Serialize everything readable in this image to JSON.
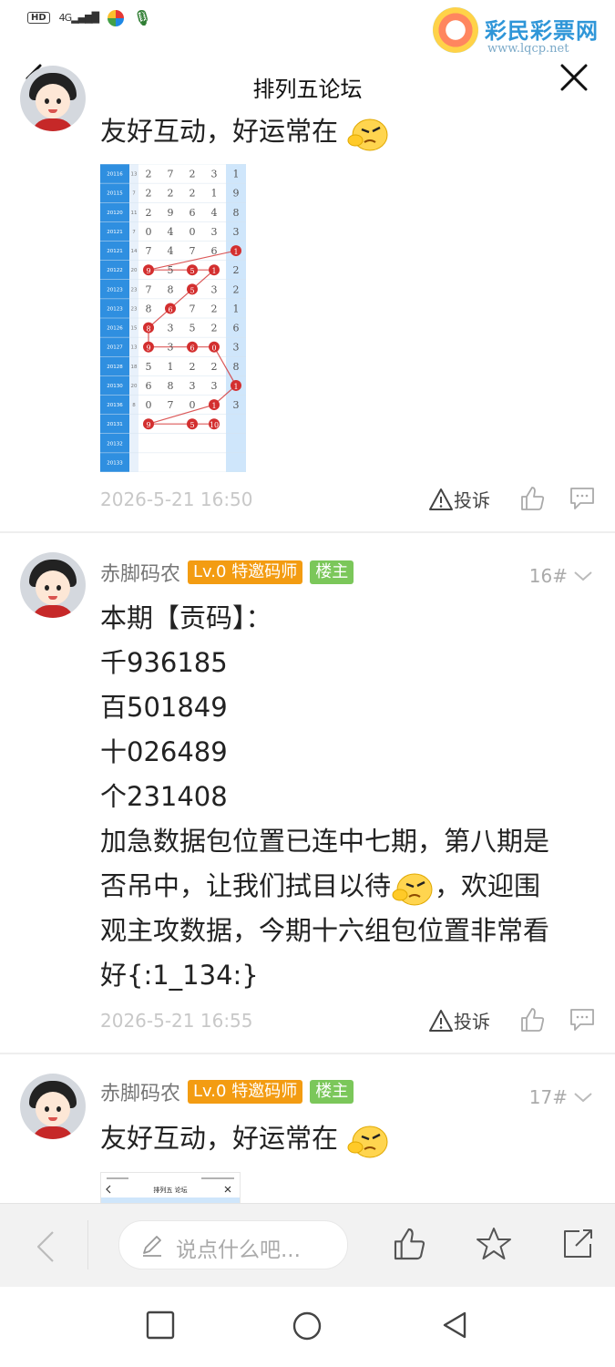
{
  "status": {
    "hd": "HD",
    "signal": "4G",
    "watermark_title": "彩民彩票网",
    "watermark_url": "www.lqcp.net"
  },
  "nav": {
    "title": "排列五论坛"
  },
  "post1": {
    "text": "友好互动，好运常在",
    "time": "2026-5-21 16:50",
    "report_label": "投诉"
  },
  "post2": {
    "author": "赤脚码农",
    "badge_level": "Lv.0 特邀码师",
    "badge_host": "楼主",
    "floor": "16#",
    "lines": [
      "本期【贡码】：",
      "千936185",
      "百501849",
      "十026489",
      "个231408",
      "加急数据包位置已连中七期，第八期是",
      "否吊中，让我们拭目以待",
      "，欢迎围",
      "观主攻数据，今期十六组包位置非常看",
      "好{:1_134:}"
    ],
    "time": "2026-5-21 16:55",
    "report_label": "投诉"
  },
  "post3": {
    "author": "赤脚码农",
    "badge_level": "Lv.0 特邀码师",
    "badge_host": "楼主",
    "floor": "17#",
    "text": "友好互动，好运常在",
    "thumb_title": "排列五 论坛"
  },
  "trend_chart": {
    "periods": [
      "20116",
      "20115",
      "20120",
      "20121",
      "20121",
      "20122",
      "20123",
      "20123",
      "20126",
      "20127",
      "20128",
      "20130",
      "20136",
      "20131",
      "20132",
      "20133"
    ],
    "sums": [
      "13",
      "7",
      "11",
      "7",
      "14",
      "20",
      "23",
      "23",
      "15",
      "13",
      "18",
      "20",
      "8",
      "",
      "",
      ""
    ],
    "rows": [
      [
        "2",
        "7",
        "2",
        "3",
        "1"
      ],
      [
        "2",
        "2",
        "2",
        "1",
        "9"
      ],
      [
        "2",
        "9",
        "6",
        "4",
        "8"
      ],
      [
        "0",
        "4",
        "0",
        "3",
        "3"
      ],
      [
        "7",
        "4",
        "7",
        "6",
        "1"
      ],
      [
        "9",
        "5",
        "5",
        "1",
        "2"
      ],
      [
        "7",
        "8",
        "5",
        "3",
        "2"
      ],
      [
        "8",
        "6",
        "7",
        "2",
        "1"
      ],
      [
        "8",
        "3",
        "5",
        "2",
        "6"
      ],
      [
        "9",
        "3",
        "6",
        "0",
        "3"
      ],
      [
        "5",
        "1",
        "2",
        "2",
        "8"
      ],
      [
        "6",
        "8",
        "3",
        "3",
        "1"
      ],
      [
        "0",
        "7",
        "0",
        "1",
        "3"
      ],
      [
        "9",
        "",
        "5",
        "10",
        ""
      ],
      [
        "",
        "",
        "",
        "",
        ""
      ],
      [
        "",
        "",
        "",
        "",
        ""
      ]
    ],
    "marked": [
      [
        4,
        4
      ],
      [
        5,
        0
      ],
      [
        5,
        2
      ],
      [
        5,
        3
      ],
      [
        6,
        2
      ],
      [
        7,
        1
      ],
      [
        8,
        0
      ],
      [
        9,
        0
      ],
      [
        9,
        2
      ],
      [
        9,
        3
      ],
      [
        11,
        4
      ],
      [
        12,
        3
      ],
      [
        13,
        0
      ],
      [
        13,
        2
      ],
      [
        13,
        3
      ]
    ]
  },
  "bottom": {
    "comment_placeholder": "说点什么吧..."
  },
  "icons": [
    "back-icon",
    "close-icon",
    "warning-icon",
    "thumbs-up-icon",
    "comment-icon",
    "pencil-icon",
    "star-icon",
    "share-icon",
    "square-nav-icon",
    "circle-nav-icon",
    "triangle-nav-icon"
  ]
}
